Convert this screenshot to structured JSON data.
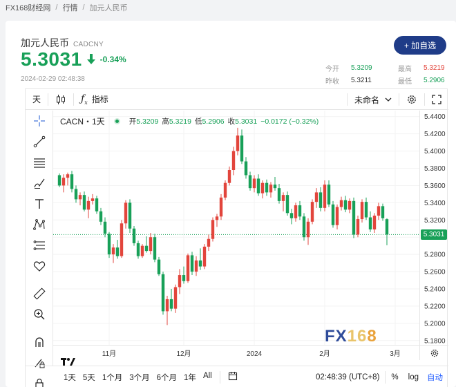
{
  "breadcrumb": {
    "site": "FX168财经网",
    "section": "行情",
    "current": "加元人民币"
  },
  "header": {
    "name": "加元人民币",
    "code": "CADCNY",
    "price": "5.3031",
    "change_pct": "-0.34%",
    "timestamp": "2024-02-29 02:48:38",
    "add_button": "+ 加自选"
  },
  "stats": {
    "open_label": "今开",
    "open": "5.3209",
    "high_label": "最高",
    "high": "5.3219",
    "prev_label": "昨收",
    "prev": "5.3211",
    "low_label": "最低",
    "low": "5.2906"
  },
  "toolbar": {
    "interval": "天",
    "indicators": "指标",
    "layout_name": "未命名"
  },
  "legend": {
    "symbol": "CACN・1天",
    "open_label": "开",
    "open": "5.3209",
    "high_label": "高",
    "high": "5.3219",
    "low_label": "低",
    "low": "5.2906",
    "close_label": "收",
    "close": "5.3031",
    "change": "−0.0172 (−0.32%)"
  },
  "last_price": "5.3031",
  "ranges": [
    "1天",
    "5天",
    "1个月",
    "3个月",
    "6个月",
    "1年",
    "All"
  ],
  "bottom": {
    "clock": "02:48:39 (UTC+8)",
    "pct": "%",
    "log": "log",
    "auto": "自动"
  },
  "colors": {
    "up": "#e2453c",
    "down": "#18a058",
    "accent": "#1f3c88"
  },
  "watermark": {
    "fx": "FX",
    "n16": "16",
    "n8": "8"
  },
  "chart_data": {
    "type": "candlestick",
    "y_ticks": [
      "5.4400",
      "5.4200",
      "5.4000",
      "5.3800",
      "5.3600",
      "5.3400",
      "5.3200",
      "5.3000",
      "5.2800",
      "5.2600",
      "5.2400",
      "5.2200",
      "5.2000",
      "5.1800"
    ],
    "x_ticks": [
      "11月",
      "12月",
      "2024",
      "2月",
      "3月"
    ],
    "ylim": [
      5.175,
      5.447
    ],
    "candles": [
      [
        5.372,
        5.374,
        5.358,
        5.36
      ],
      [
        5.36,
        5.373,
        5.352,
        5.369
      ],
      [
        5.369,
        5.375,
        5.36,
        5.373
      ],
      [
        5.373,
        5.377,
        5.352,
        5.356
      ],
      [
        5.356,
        5.36,
        5.34,
        5.344
      ],
      [
        5.344,
        5.352,
        5.337,
        5.349
      ],
      [
        5.349,
        5.353,
        5.33,
        5.332
      ],
      [
        5.332,
        5.347,
        5.322,
        5.342
      ],
      [
        5.342,
        5.35,
        5.338,
        5.345
      ],
      [
        5.345,
        5.348,
        5.327,
        5.33
      ],
      [
        5.33,
        5.334,
        5.314,
        5.318
      ],
      [
        5.318,
        5.323,
        5.3,
        5.304
      ],
      [
        5.304,
        5.306,
        5.276,
        5.28
      ],
      [
        5.28,
        5.292,
        5.27,
        5.288
      ],
      [
        5.288,
        5.297,
        5.275,
        5.278
      ],
      [
        5.278,
        5.32,
        5.276,
        5.316
      ],
      [
        5.316,
        5.343,
        5.31,
        5.34
      ],
      [
        5.34,
        5.344,
        5.305,
        5.31
      ],
      [
        5.31,
        5.313,
        5.29,
        5.293
      ],
      [
        5.293,
        5.296,
        5.275,
        5.278
      ],
      [
        5.278,
        5.292,
        5.276,
        5.29
      ],
      [
        5.29,
        5.301,
        5.282,
        5.284
      ],
      [
        5.284,
        5.305,
        5.28,
        5.3
      ],
      [
        5.3,
        5.304,
        5.271,
        5.274
      ],
      [
        5.274,
        5.277,
        5.255,
        5.257
      ],
      [
        5.257,
        5.26,
        5.21,
        5.214
      ],
      [
        5.214,
        5.232,
        5.198,
        5.228
      ],
      [
        5.228,
        5.24,
        5.214,
        5.217
      ],
      [
        5.217,
        5.245,
        5.212,
        5.242
      ],
      [
        5.242,
        5.263,
        5.234,
        5.256
      ],
      [
        5.256,
        5.266,
        5.246,
        5.249
      ],
      [
        5.249,
        5.281,
        5.247,
        5.279
      ],
      [
        5.279,
        5.283,
        5.256,
        5.26
      ],
      [
        5.26,
        5.278,
        5.255,
        5.273
      ],
      [
        5.273,
        5.287,
        5.262,
        5.266
      ],
      [
        5.266,
        5.292,
        5.263,
        5.289
      ],
      [
        5.289,
        5.303,
        5.284,
        5.298
      ],
      [
        5.298,
        5.323,
        5.295,
        5.32
      ],
      [
        5.32,
        5.327,
        5.312,
        5.324
      ],
      [
        5.324,
        5.35,
        5.32,
        5.346
      ],
      [
        5.346,
        5.366,
        5.343,
        5.363
      ],
      [
        5.363,
        5.382,
        5.36,
        5.378
      ],
      [
        5.378,
        5.405,
        5.372,
        5.4
      ],
      [
        5.4,
        5.427,
        5.395,
        5.418
      ],
      [
        5.418,
        5.425,
        5.385,
        5.388
      ],
      [
        5.388,
        5.393,
        5.368,
        5.372
      ],
      [
        5.372,
        5.376,
        5.354,
        5.357
      ],
      [
        5.357,
        5.372,
        5.352,
        5.368
      ],
      [
        5.368,
        5.373,
        5.348,
        5.351
      ],
      [
        5.351,
        5.366,
        5.345,
        5.363
      ],
      [
        5.363,
        5.367,
        5.348,
        5.352
      ],
      [
        5.352,
        5.364,
        5.346,
        5.361
      ],
      [
        5.361,
        5.37,
        5.354,
        5.357
      ],
      [
        5.357,
        5.362,
        5.339,
        5.342
      ],
      [
        5.342,
        5.352,
        5.33,
        5.349
      ],
      [
        5.349,
        5.353,
        5.325,
        5.328
      ],
      [
        5.328,
        5.333,
        5.315,
        5.322
      ],
      [
        5.322,
        5.34,
        5.318,
        5.337
      ],
      [
        5.337,
        5.342,
        5.32,
        5.324
      ],
      [
        5.324,
        5.328,
        5.296,
        5.3
      ],
      [
        5.3,
        5.322,
        5.291,
        5.318
      ],
      [
        5.318,
        5.344,
        5.315,
        5.341
      ],
      [
        5.341,
        5.357,
        5.334,
        5.352
      ],
      [
        5.352,
        5.358,
        5.33,
        5.334
      ],
      [
        5.334,
        5.366,
        5.33,
        5.361
      ],
      [
        5.361,
        5.366,
        5.335,
        5.338
      ],
      [
        5.338,
        5.342,
        5.311,
        5.314
      ],
      [
        5.314,
        5.338,
        5.309,
        5.335
      ],
      [
        5.335,
        5.347,
        5.331,
        5.343
      ],
      [
        5.343,
        5.348,
        5.329,
        5.332
      ],
      [
        5.332,
        5.345,
        5.328,
        5.342
      ],
      [
        5.342,
        5.346,
        5.299,
        5.303
      ],
      [
        5.303,
        5.325,
        5.3,
        5.321
      ],
      [
        5.321,
        5.344,
        5.317,
        5.341
      ],
      [
        5.341,
        5.346,
        5.32,
        5.323
      ],
      [
        5.323,
        5.33,
        5.306,
        5.309
      ],
      [
        5.309,
        5.328,
        5.305,
        5.325
      ],
      [
        5.325,
        5.34,
        5.32,
        5.336
      ],
      [
        5.336,
        5.339,
        5.319,
        5.322
      ],
      [
        5.3209,
        5.3219,
        5.2906,
        5.3031
      ]
    ]
  }
}
